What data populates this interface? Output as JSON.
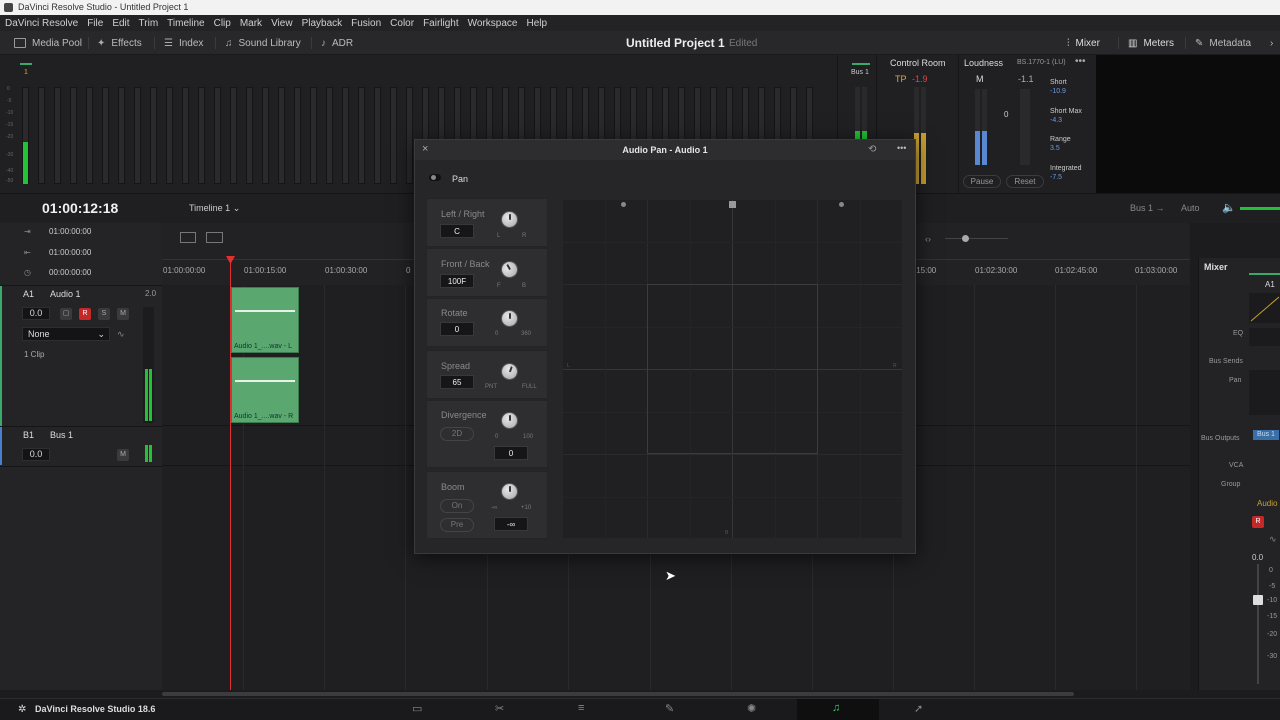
{
  "window": {
    "title": "DaVinci Resolve Studio - Untitled Project 1"
  },
  "menu": [
    "DaVinci Resolve",
    "File",
    "Edit",
    "Trim",
    "Timeline",
    "Clip",
    "Mark",
    "View",
    "Playback",
    "Fusion",
    "Color",
    "Fairlight",
    "Workspace",
    "Help"
  ],
  "toolbar": {
    "media_pool": "Media Pool",
    "effects": "Effects",
    "index": "Index",
    "sound_library": "Sound Library",
    "adr": "ADR",
    "project_title": "Untitled Project 1",
    "edited": "Edited",
    "mixer": "Mixer",
    "meters": "Meters",
    "metadata": "Metadata"
  },
  "meters": {
    "channel_number": "1",
    "scale": [
      "0",
      "-5",
      "-10",
      "-15",
      "-20",
      "-30",
      "-40",
      "-50"
    ],
    "bus_label": "Bus 1",
    "control_room": "Control Room",
    "tp_label": "TP",
    "tp_value": "-1.9",
    "loudness": "Loudness",
    "standard": "BS.1770-1 (LU)",
    "m_label": "M",
    "m_value": "-1.1",
    "m_center": "0",
    "pause": "Pause",
    "reset": "Reset",
    "short_label": "Short",
    "short_value": "-10.9",
    "short_max_label": "Short Max",
    "short_max_value": "-4.3",
    "range_label": "Range",
    "range_value": "3.5",
    "integrated_label": "Integrated",
    "integrated_value": "-7.5"
  },
  "timeline": {
    "timecode": "01:00:12:18",
    "name": "Timeline 1",
    "tc_rows": [
      "01:00:00:00",
      "01:00:00:00",
      "00:00:00:00"
    ],
    "ruler": [
      "01:00:00:00",
      "01:00:15:00",
      "01:00:30:00",
      "0",
      ":15:00",
      "01:02:30:00",
      "01:02:45:00",
      "01:03:00:00"
    ],
    "bus_route": "Bus 1",
    "auto": "Auto",
    "track_a1": {
      "id": "A1",
      "name": "Audio 1",
      "ch": "2.0",
      "vol": "0.0",
      "r": "R",
      "s": "S",
      "m": "M",
      "effect": "None",
      "clips": "1 Clip"
    },
    "track_b1": {
      "id": "B1",
      "name": "Bus 1",
      "vol": "0.0",
      "m": "M"
    },
    "clip_l": "Audio 1_....wav - L",
    "clip_r": "Audio 1_....wav - R"
  },
  "mixer": {
    "title": "Mixer",
    "channel": "A1",
    "eq": "EQ",
    "bus_sends": "Bus Sends",
    "pan": "Pan",
    "bus_outputs": "Bus Outputs",
    "bus_out_val": "Bus 1",
    "vca": "VCA",
    "group": "Group",
    "audio": "Audio",
    "r": "R",
    "level": "0.0",
    "fader_scale": [
      "0",
      "-5",
      "-10",
      "-15",
      "-20",
      "-30"
    ]
  },
  "dialog": {
    "title": "Audio Pan - Audio 1",
    "close": "×",
    "pan_label": "Pan",
    "left_right": {
      "label": "Left / Right",
      "value": "C",
      "min": "L",
      "max": "R"
    },
    "front_back": {
      "label": "Front / Back",
      "value": "100F",
      "min": "F",
      "max": "B"
    },
    "rotate": {
      "label": "Rotate",
      "value": "0",
      "min": "0",
      "max": "360"
    },
    "spread": {
      "label": "Spread",
      "value": "65",
      "min": "PNT",
      "max": "FULL"
    },
    "divergence": {
      "label": "Divergence",
      "mode": "2D",
      "min": "0",
      "max": "100",
      "value": "0"
    },
    "boom": {
      "label": "Boom",
      "on": "On",
      "pre": "Pre",
      "min": "-∞",
      "max": "+10",
      "value": "-∞"
    },
    "grid_left": "L",
    "grid_right": "R",
    "grid_bottom": "B"
  },
  "footer": {
    "app": "DaVinci Resolve Studio 18.6"
  }
}
